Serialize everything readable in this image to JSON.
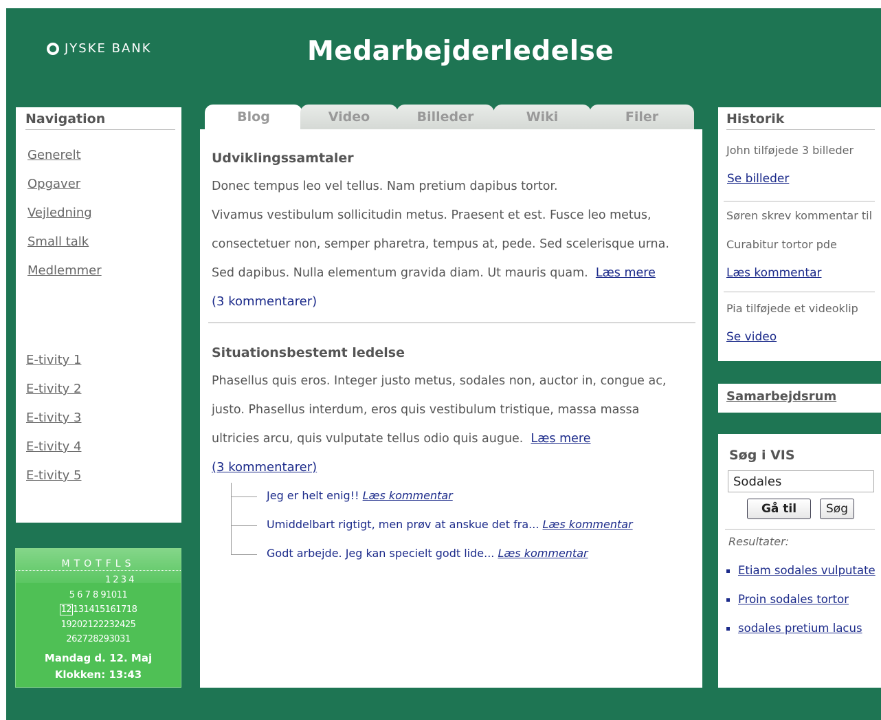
{
  "header": {
    "logo_text": "JYSKE BANK",
    "title": "Medarbejderledelse"
  },
  "navigation": {
    "title": "Navigation",
    "items": [
      "Generelt",
      "Opgaver",
      "Vejledning",
      "Small talk",
      "Medlemmer"
    ],
    "etivities": [
      "E-tivity 1",
      "E-tivity 2",
      "E-tivity 3",
      "E-tivity 4",
      "E-tivity 5"
    ]
  },
  "calendar": {
    "weekdays": "MTOTFLS",
    "rows": [
      "1 2 3 4",
      "5 6 7 8 91011",
      "13141516171 8",
      "19202122232425",
      "262728293031"
    ],
    "today": "12",
    "date_text": "Mandag d. 12. Maj",
    "time_text": "Klokken: 13:43"
  },
  "tabs": [
    "Blog",
    "Video",
    "Billeder",
    "Wiki",
    "Filer"
  ],
  "posts": [
    {
      "title": "Udviklingssamtaler",
      "lines": [
        "Donec tempus leo vel tellus. Nam pretium dapibus tortor.",
        "Vivamus vestibulum sollicitudin metus. Praesent et est. Fusce leo metus,",
        "consectetuer non, semper pharetra, tempus at, pede. Sed scelerisque urna.",
        "Sed dapibus. Nulla elementum gravida diam. Ut mauris quam."
      ],
      "more": "Læs mere",
      "comments": "(3 kommentarer)"
    },
    {
      "title": "Situationsbestemt ledelse",
      "lines": [
        "Phasellus quis eros. Integer justo metus, sodales non, auctor in, congue ac,",
        "justo. Phasellus interdum, eros quis vestibulum tristique, massa massa",
        "ultricies arcu, quis vulputate tellus odio quis augue."
      ],
      "more": "Læs mere",
      "comments": "(3 kommentarer)",
      "replies": [
        {
          "text": "Jeg er helt enig!!",
          "link": "Læs kommentar"
        },
        {
          "text": "Umiddelbart rigtigt, men prøv at anskue det fra...",
          "link": "Læs kommentar"
        },
        {
          "text": "Godt arbejde. Jeg kan specielt godt lide...",
          "link": "Læs kommentar"
        }
      ]
    }
  ],
  "history": {
    "title": "Historik",
    "entries": [
      {
        "lines": [
          "John tilføjede 3 billeder"
        ],
        "link": "Se billeder"
      },
      {
        "lines": [
          "Søren skrev kommentar til",
          "Curabitur tortor pde"
        ],
        "link": "Læs kommentar"
      },
      {
        "lines": [
          "Pia tilføjede et videoklip"
        ],
        "link": "Se video"
      }
    ]
  },
  "samarbejdsrum": {
    "label": "Samarbejdsrum"
  },
  "search": {
    "title": "Søg i VIS",
    "value": "Sodales",
    "goto_label": "Gå til",
    "search_label": "Søg",
    "results_label": "Resultater:",
    "results": [
      "Etiam sodales vulputate",
      "Proin sodales tortor",
      "sodales pretium lacus"
    ]
  }
}
